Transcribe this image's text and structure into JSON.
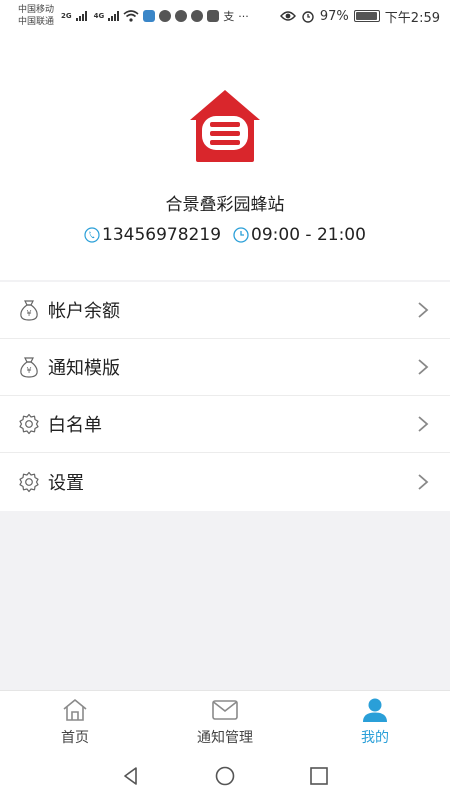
{
  "status_bar": {
    "carrier_1": "中国移动",
    "carrier_2": "中国联通",
    "sig_1": "2G",
    "sig_2": "4G",
    "more": "···",
    "battery": "97%",
    "time": "下午2:59"
  },
  "profile": {
    "station_name": "合景叠彩园蜂站",
    "phone": "13456978219",
    "hours": "09:00 - 21:00"
  },
  "menu": {
    "items": [
      {
        "label": "帐户余额",
        "icon": "money-bag-icon"
      },
      {
        "label": "通知模版",
        "icon": "money-bag-icon"
      },
      {
        "label": "白名单",
        "icon": "gear-icon"
      },
      {
        "label": "设置",
        "icon": "gear-icon"
      }
    ]
  },
  "tabs": [
    {
      "label": "首页",
      "icon": "home-icon"
    },
    {
      "label": "通知管理",
      "icon": "mail-icon"
    },
    {
      "label": "我的",
      "icon": "user-icon"
    }
  ],
  "colors": {
    "accent": "#2a9fd8",
    "logo_red": "#d9262c"
  }
}
